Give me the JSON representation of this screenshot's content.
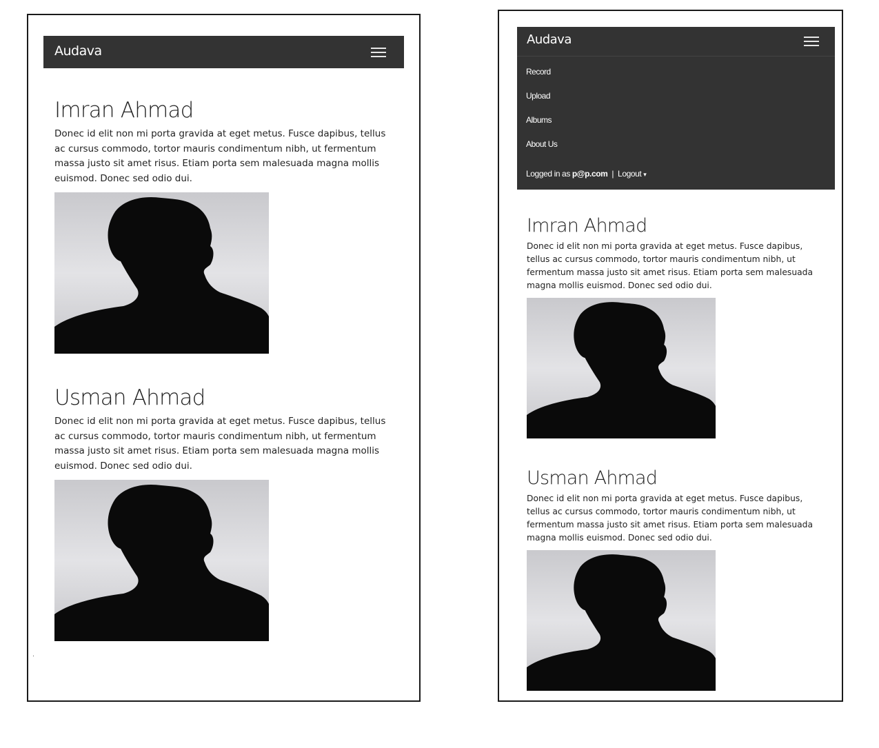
{
  "collapsed_view": {
    "navbar": {
      "brand": "Audava",
      "toggle_icon": "hamburger-menu-icon"
    },
    "people": [
      {
        "name": "Imran Ahmad",
        "bio": "Donec id elit non mi porta gravida at eget metus. Fusce dapibus, tellus ac cursus commodo, tortor mauris condimentum nibh, ut fermentum massa justo sit amet risus. Etiam porta sem malesuada magna mollis euismod. Donec sed odio dui.",
        "photo_icon": "person-silhouette-icon"
      },
      {
        "name": "Usman Ahmad",
        "bio": "Donec id elit non mi porta gravida at eget metus. Fusce dapibus, tellus ac cursus commodo, tortor mauris condimentum nibh, ut fermentum massa justo sit amet risus. Etiam porta sem malesuada magna mollis euismod. Donec sed odio dui.",
        "photo_icon": "person-silhouette-icon"
      }
    ]
  },
  "expanded_view": {
    "navbar": {
      "brand": "Audava",
      "toggle_icon": "hamburger-menu-icon",
      "menu_items": [
        "Record",
        "Upload",
        "Albums",
        "About Us"
      ],
      "login": {
        "prefix": "Logged in as",
        "user": "p@p.com",
        "separator": "|",
        "logout_label": "Logout",
        "logout_caret": "▾"
      }
    },
    "people": [
      {
        "name": "Imran Ahmad",
        "bio": "Donec id elit non mi porta gravida at eget metus. Fusce dapibus, tellus ac cursus commodo, tortor mauris condimentum nibh, ut fermentum massa justo sit amet risus. Etiam porta sem malesuada magna mollis euismod. Donec sed odio dui.",
        "photo_icon": "person-silhouette-icon"
      },
      {
        "name": "Usman Ahmad",
        "bio": "Donec id elit non mi porta gravida at eget metus. Fusce dapibus, tellus ac cursus commodo, tortor mauris condimentum nibh, ut fermentum massa justo sit amet risus. Etiam porta sem malesuada magna mollis euismod. Donec sed odio dui.",
        "photo_icon": "person-silhouette-icon"
      }
    ]
  },
  "colors": {
    "navbar_bg": "#333333",
    "navbar_text": "#ffffff",
    "page_bg": "#ffffff",
    "photo_bg_light": "#e6e6e9",
    "photo_bg_dark": "#c8c8cc",
    "silhouette": "#0a0a0a"
  }
}
